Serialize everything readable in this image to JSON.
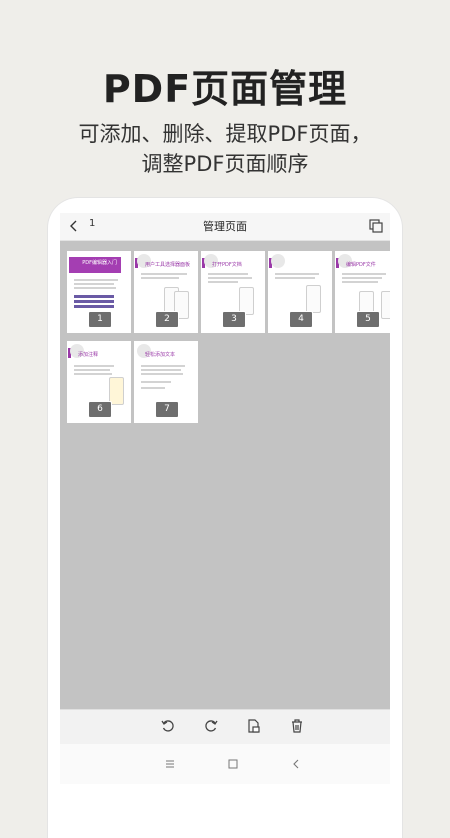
{
  "promo": {
    "headline": "PDF页面管理",
    "subtitle_line1": "可添加、删除、提取PDF页面，",
    "subtitle_line2": "调整PDF页面顺序"
  },
  "header": {
    "page_number": "1",
    "title": "管理页面"
  },
  "pages": [
    {
      "number": "1",
      "heading": "PDF编辑器入门"
    },
    {
      "number": "2",
      "heading": "用户工具选择器面板"
    },
    {
      "number": "3",
      "heading": "打开PDF文档"
    },
    {
      "number": "4",
      "heading": ""
    },
    {
      "number": "5",
      "heading": "编辑PDF文件"
    },
    {
      "number": "6",
      "heading": "添加注释"
    },
    {
      "number": "7",
      "heading": "轻松添加文本"
    }
  ],
  "toolbar": {
    "icons": [
      "rotate-left-icon",
      "rotate-right-icon",
      "extract-page-icon",
      "delete-icon"
    ]
  },
  "system_nav": {
    "icons": [
      "menu-icon",
      "home-icon",
      "back-icon"
    ]
  },
  "colors": {
    "accent": "#a43eb2",
    "grid_background": "#c3c3c3",
    "badge": "#6e6e6e"
  }
}
